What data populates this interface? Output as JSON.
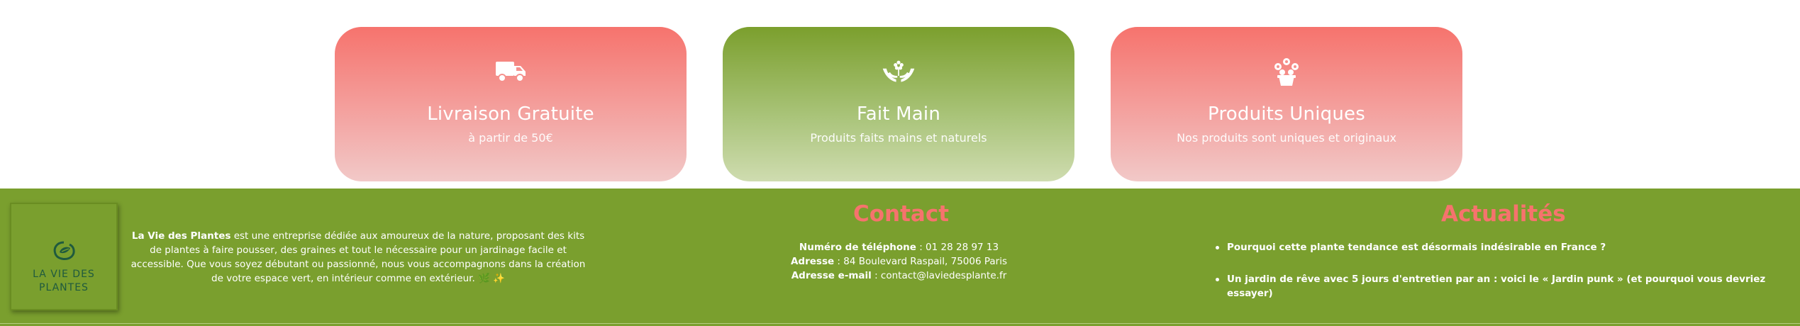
{
  "features": [
    {
      "icon": "truck-icon",
      "title": "Livraison Gratuite",
      "subtitle": "à partir de 50€"
    },
    {
      "icon": "hands-flower-icon",
      "title": "Fait Main",
      "subtitle": "Produits faits mains et naturels"
    },
    {
      "icon": "flower-pot-icon",
      "title": "Produits Uniques",
      "subtitle": "Nos produits sont uniques et originaux"
    }
  ],
  "footer": {
    "logo": {
      "line1": "LA VIE DES",
      "line2": "PLANTES"
    },
    "about": {
      "brand": "La Vie des Plantes",
      "text": " est une entreprise dédiée aux amoureux de la nature, proposant des kits de plantes à faire pousser, des graines et tout le nécessaire pour un jardinage facile et accessible. Que vous soyez débutant ou passionné, nous vous accompagnons dans la création de votre espace vert, en intérieur comme en extérieur. 🌿 ✨"
    },
    "contact": {
      "title": "Contact",
      "phone_label": "Numéro de téléphone",
      "phone": " : 01 28 28 97 13",
      "address_label": "Adresse",
      "address": " : 84 Boulevard Raspail, 75006 Paris",
      "email_label": "Adresse e-mail",
      "email": " : contact@laviedesplante.fr"
    },
    "news": {
      "title": "Actualités",
      "items": [
        "Pourquoi cette plante tendance est désormais indésirable en France ?",
        "Un jardin de rêve avec 5 jours d'entretien par an : voici le « Jardin punk » (et pourquoi vous devriez essayer)"
      ]
    }
  },
  "colors": {
    "accent": "#f6736d",
    "green": "#7a9f2e",
    "logo_green": "#1f5a3e"
  }
}
